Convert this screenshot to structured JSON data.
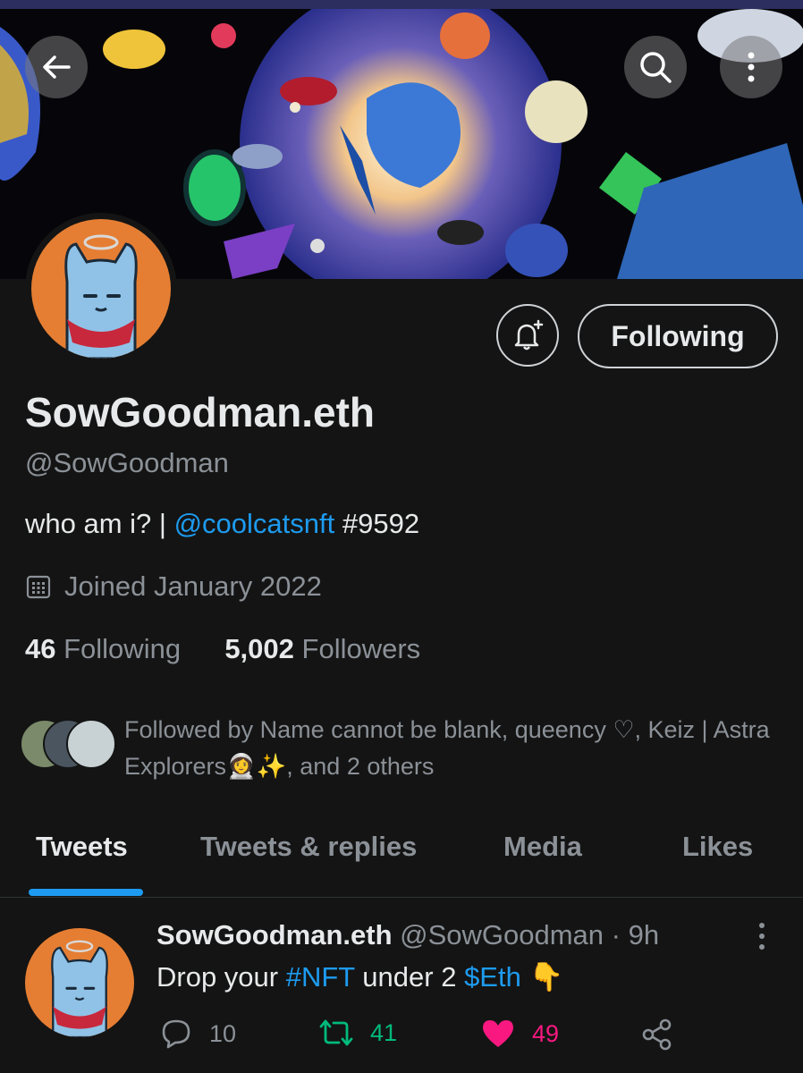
{
  "colors": {
    "background": "#141414",
    "accent": "#1d9bf0",
    "retweet": "#00ba7c",
    "like": "#f91880",
    "muted": "#8b9197"
  },
  "header": {
    "back_icon": "arrow-left-icon",
    "search_icon": "search-icon",
    "more_icon": "more-vertical-icon"
  },
  "profile": {
    "display_name": "SowGoodman.eth",
    "handle": "@SowGoodman",
    "bio_prefix": "who am i? | ",
    "bio_mention": "@coolcatsnft",
    "bio_suffix": " #9592",
    "joined": "Joined January 2022",
    "following_count": "46",
    "following_label": "Following",
    "followers_count": "5,002",
    "followers_label": "Followers",
    "follow_button": "Following",
    "notify_icon": "bell-plus-icon",
    "followed_by": "Followed by Name cannot be blank, queency ♡, Keiz | Astra Explorers👩‍🚀✨, and 2 others"
  },
  "tabs": [
    {
      "label": "Tweets",
      "active": true
    },
    {
      "label": "Tweets & replies",
      "active": false
    },
    {
      "label": "Media",
      "active": false
    },
    {
      "label": "Likes",
      "active": false
    }
  ],
  "tweet": {
    "name": "SowGoodman.eth",
    "handle": "@SowGoodman",
    "separator": " · ",
    "time": "9h",
    "text_before": "Drop your ",
    "hashtag": "#NFT",
    "text_middle": " under 2 ",
    "cashtag": "$Eth",
    "emoji": " 👇",
    "replies": "10",
    "retweets": "41",
    "likes": "49"
  }
}
